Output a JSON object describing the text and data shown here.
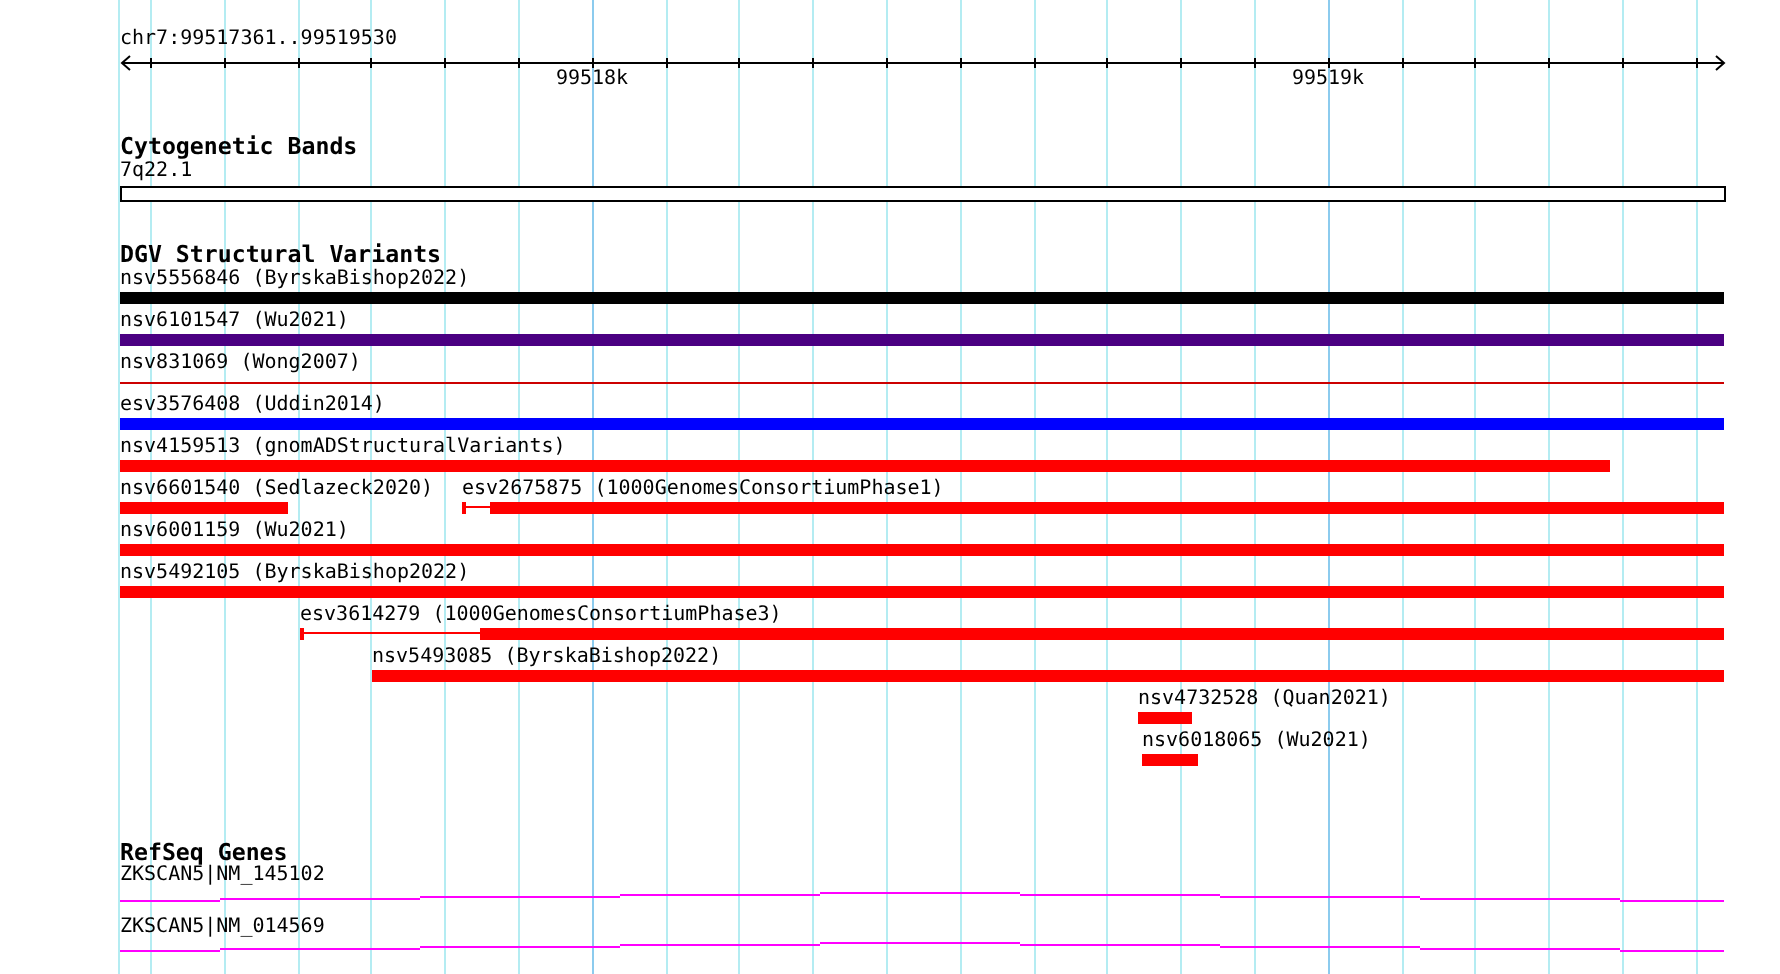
{
  "ruler": {
    "position": "chr7:99517361..99519530",
    "ticks": [
      "99518k",
      "99519k"
    ]
  },
  "tracks": [
    {
      "kind": "bands",
      "title": "Cytogenetic Bands",
      "items": [
        {
          "label": "7q22.1"
        }
      ]
    },
    {
      "kind": "variants",
      "title": "DGV Structural Variants",
      "rows": [
        {
          "features": [
            {
              "label": "nsv5556846 (ByrskaBishop2022)",
              "color": "#000000",
              "kind": "bar"
            }
          ]
        },
        {
          "features": [
            {
              "label": "nsv6101547 (Wu2021)",
              "color": "#4b0082",
              "kind": "bar"
            }
          ]
        },
        {
          "features": [
            {
              "label": "nsv831069 (Wong2007)",
              "color": "#cc0000",
              "kind": "thin"
            }
          ]
        },
        {
          "features": [
            {
              "label": "esv3576408 (Uddin2014)",
              "color": "#0000ff",
              "kind": "bar"
            }
          ]
        },
        {
          "features": [
            {
              "label": "nsv4159513 (gnomADStructuralVariants)",
              "color": "#ff0000",
              "kind": "bar"
            }
          ]
        },
        {
          "features": [
            {
              "label": "nsv6601540 (Sedlazeck2020)",
              "color": "#ff0000",
              "kind": "bar"
            },
            {
              "label": "esv2675875 (1000GenomesConsortiumPhase1)",
              "color": "#ff0000",
              "kind": "split"
            }
          ]
        },
        {
          "features": [
            {
              "label": "nsv6001159 (Wu2021)",
              "color": "#ff0000",
              "kind": "bar"
            }
          ]
        },
        {
          "features": [
            {
              "label": "nsv5492105 (ByrskaBishop2022)",
              "color": "#ff0000",
              "kind": "bar"
            }
          ]
        },
        {
          "features": [
            {
              "label": "esv3614279 (1000GenomesConsortiumPhase3)",
              "color": "#ff0000",
              "kind": "split"
            }
          ]
        },
        {
          "features": [
            {
              "label": "nsv5493085 (ByrskaBishop2022)",
              "color": "#ff0000",
              "kind": "bar"
            }
          ]
        },
        {
          "features": [
            {
              "label": "nsv4732528 (Quan2021)",
              "color": "#ff0000",
              "kind": "bar"
            }
          ]
        },
        {
          "features": [
            {
              "label": "nsv6018065 (Wu2021)",
              "color": "#ff0000",
              "kind": "bar"
            }
          ]
        }
      ]
    },
    {
      "kind": "genes",
      "title": "RefSeq Genes",
      "items": [
        {
          "label": "ZKSCAN5|NM_145102"
        },
        {
          "label": "ZKSCAN5|NM_014569"
        }
      ]
    }
  ]
}
